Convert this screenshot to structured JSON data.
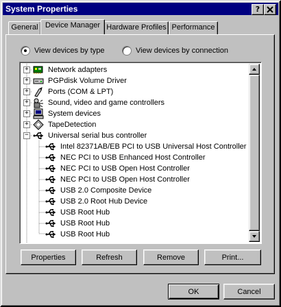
{
  "window": {
    "title": "System Properties",
    "help_button": "?",
    "close_button": "X"
  },
  "tabs": [
    {
      "label": "General",
      "active": false
    },
    {
      "label": "Device Manager",
      "active": true
    },
    {
      "label": "Hardware Profiles",
      "active": false
    },
    {
      "label": "Performance",
      "active": false
    }
  ],
  "view_options": {
    "by_type": {
      "label": "View devices by type",
      "checked": true
    },
    "by_connection": {
      "label": "View devices by connection",
      "checked": false
    }
  },
  "tree": {
    "items": [
      {
        "label": "Network adapters",
        "icon": "network-adapter-icon",
        "expander": "+"
      },
      {
        "label": "PGPdisk Volume Driver",
        "icon": "disk-drive-icon",
        "expander": "+"
      },
      {
        "label": "Ports (COM & LPT)",
        "icon": "port-icon",
        "expander": "+"
      },
      {
        "label": "Sound, video and game controllers",
        "icon": "sound-icon",
        "expander": "+"
      },
      {
        "label": "System devices",
        "icon": "computer-icon",
        "expander": "+"
      },
      {
        "label": "TapeDetection",
        "icon": "tape-icon",
        "expander": "+"
      },
      {
        "label": "Universal serial bus controller",
        "icon": "usb-icon",
        "expander": "−"
      }
    ],
    "children": [
      {
        "label": "Intel 82371AB/EB PCI to USB Universal Host Controller",
        "icon": "usb-icon"
      },
      {
        "label": "NEC PCI to USB Enhanced Host Controller",
        "icon": "usb-icon"
      },
      {
        "label": "NEC PCI to USB Open Host Controller",
        "icon": "usb-icon"
      },
      {
        "label": "NEC PCI to USB Open Host Controller",
        "icon": "usb-icon"
      },
      {
        "label": "USB 2.0 Composite Device",
        "icon": "usb-icon"
      },
      {
        "label": "USB 2.0 Root Hub Device",
        "icon": "usb-icon"
      },
      {
        "label": "USB Root Hub",
        "icon": "usb-icon"
      },
      {
        "label": "USB Root Hub",
        "icon": "usb-icon"
      },
      {
        "label": "USB Root Hub",
        "icon": "usb-icon"
      }
    ]
  },
  "actions": {
    "properties": "Properties",
    "refresh": "Refresh",
    "remove": "Remove",
    "print": "Print..."
  },
  "footer": {
    "ok": "OK",
    "cancel": "Cancel"
  },
  "colors": {
    "titlebar": "#000080",
    "face": "#c0c0c0"
  }
}
